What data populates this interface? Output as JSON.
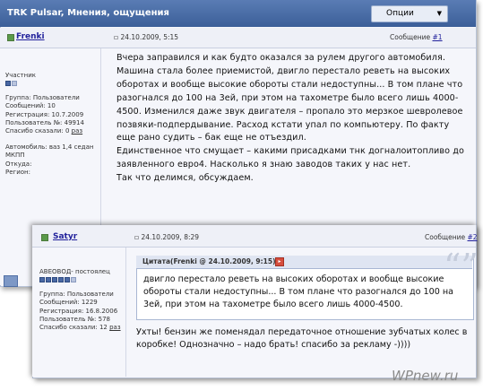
{
  "thread": {
    "title": "TRK Pulsar, Мнения, ощущения",
    "options_button": "Опции"
  },
  "post1": {
    "username": "Frenki",
    "date": "24.10.2009, 5:15",
    "message_label": "Сообщение",
    "message_number": "#1",
    "sidebar": {
      "rank": "Участник",
      "group": "Группа: Пользователи",
      "messages": "Сообщений: 10",
      "registration": "Регистрация: 10.7.2009",
      "user_number": "Пользователь №: 49914",
      "thanks": "Спасибо сказали: 0",
      "thanks_link": "раз",
      "car": "Автомобиль: ваз 1,4 седан",
      "car2": "МКПП",
      "from": "Откуда:",
      "region": "Регион:"
    },
    "body": [
      "Вчера заправился и как будто оказался за рулем другого автомобиля. Машина стала более приемистой, двигло перестало реветь на высоких оборотах и вообще высокие обороты стали недоступны... В том плане что разогнался до 100 на 3ей, при этом на тахометре было всего лишь 4000-4500. Изменился даже звук двигателя – пропало это мерзкое шевролевое позвяки-подпердывание. Расход кстати упал по компьютеру. По факту еще рано судить – бак еще не отъездил.",
      "Единственное что смущает – какими присадками тнк догналоитопливо до заявленного евро4. Насколько я знаю заводов таких у нас нет.",
      "Так что делимся, обсуждаем."
    ]
  },
  "post2": {
    "username": "Satyr",
    "date": "24.10.2009, 8:29",
    "message_label": "Сообщение",
    "message_number": "#2",
    "sidebar": {
      "rank": "АВЕОВОД- постоялец",
      "group": "Группа: Пользователи",
      "messages": "Сообщений: 1229",
      "registration": "Регистрация: 16.8.2006",
      "user_number": "Пользователь №: 578",
      "thanks": "Спасибо сказали: 12",
      "thanks_link": "раз"
    },
    "quote_header": "Цитата(Frenki @ 24.10.2009, 9:15)",
    "quote_text": "двигло перестало реветь на высоких оборотах и вообще высокие обороты стали недоступны... В том плане что разогнался до 100 на 3ей, при этом на тахометре было всего лишь 4000-4500.",
    "reply_text": "Ухты! бензин же поменядал передаточное отношение зубчатых колес в коробке! Однозначно – надо брать! спасибо за рекламу -))))"
  },
  "watermark": "WPnew.ru",
  "colors": {
    "header_blue": "#3c5f99",
    "username_link": "#22229c",
    "panel_bg": "#f5f6fb"
  }
}
